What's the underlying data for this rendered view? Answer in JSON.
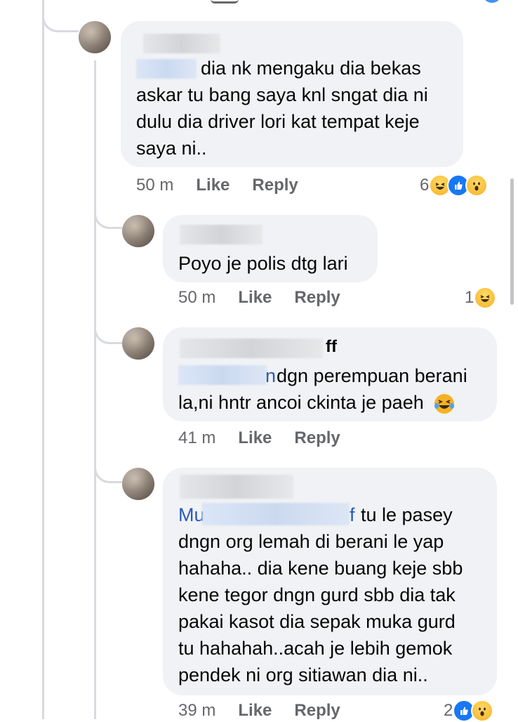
{
  "comments": [
    {
      "mention_visible": "",
      "text": "dia nk mengaku dia bekas\naskar tu bang saya knl sngat dia ni\ndulu dia driver lori kat tempat keje\nsaya ni..",
      "time": "50 m",
      "like": "Like",
      "reply": "Reply",
      "reaction_count": "6",
      "reactions": [
        "haha-icon",
        "like-icon",
        "wow-icon"
      ]
    },
    {
      "text": "Poyo je polis dtg lari",
      "time": "50 m",
      "like": "Like",
      "reply": "Reply",
      "reaction_count": "1",
      "reactions": [
        "haha-icon"
      ]
    },
    {
      "name_suffix": "ff",
      "mention_suffix": "n",
      "text_line1": "dgn perempuan berani",
      "text_line2": "la,ni hntr ancoi ckinta je paeh",
      "time": "41 m",
      "like": "Like",
      "reply": "Reply"
    },
    {
      "mention_prefix": "Mu",
      "mention_suffix": "f",
      "text_line1": "tu le pasey",
      "text_rest": "dngn org lemah di berani le yap\nhahaha.. dia kene buang keje sbb\nkene tegor dngn gurd sbb dia tak\npakai kasot dia sepak muka gurd\ntu hahahah..acah je lebih gemok\npendek ni org sitiawan dia ni..",
      "time": "39 m",
      "like": "Like",
      "reply": "Reply",
      "reaction_count": "2",
      "reactions": [
        "like-icon",
        "wow-icon"
      ]
    }
  ]
}
